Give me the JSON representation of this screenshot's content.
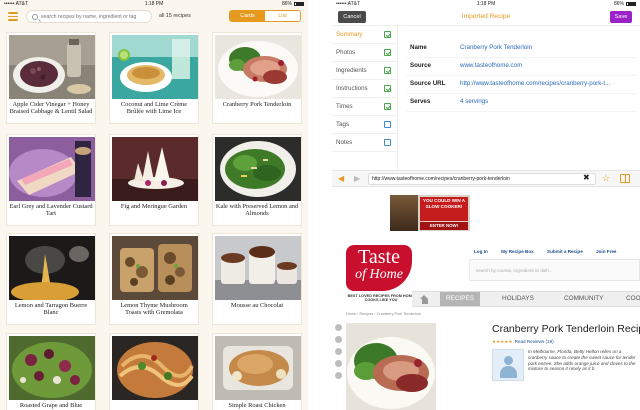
{
  "left": {
    "status": {
      "carrier": "•••••• AT&T",
      "time": "1:18 PM",
      "battery": "86%"
    },
    "search": {
      "placeholder": "search recipes by name, ingredient or tag"
    },
    "count": "all 15 recipes",
    "view_toggle": {
      "cards": "Cards",
      "list": "List",
      "active": "Cards"
    },
    "recipes": [
      {
        "title": "Apple Cider Vinegar + Honey Braised Cabbage & Lentil Salad"
      },
      {
        "title": "Coconut and Lime Crème Brûlée with Lime Ice"
      },
      {
        "title": "Cranberry Pork Tenderloin"
      },
      {
        "title": "Earl Grey and Lavender Custard Tart"
      },
      {
        "title": "Fig and Meringue Garden"
      },
      {
        "title": "Kale with Preserved Lemon and Almonds"
      },
      {
        "title": "Lemon and Tarragon Buerre Blanc"
      },
      {
        "title": "Lemon Thyme Mushroom Toasts with Gremolata"
      },
      {
        "title": "Mousse au Chocolat"
      },
      {
        "title": "Roasted Grape and Blue"
      },
      {
        "title": ""
      },
      {
        "title": "Simple Roast Chicken"
      }
    ]
  },
  "right": {
    "status": {
      "carrier": "•••••• AT&T",
      "time": "1:18 PM",
      "battery": "86%"
    },
    "toolbar": {
      "cancel": "Cancel",
      "title": "Imported Recipe",
      "save": "Save"
    },
    "sections": [
      {
        "label": "Summary",
        "checked": true
      },
      {
        "label": "Photos",
        "checked": true
      },
      {
        "label": "Ingredients",
        "checked": true
      },
      {
        "label": "Instructions",
        "checked": true
      },
      {
        "label": "Times",
        "checked": true
      },
      {
        "label": "Tags",
        "checked": false
      },
      {
        "label": "Notes",
        "checked": false
      }
    ],
    "fields": [
      {
        "label": "Name",
        "value": "Cranberry Pork Tenderloin"
      },
      {
        "label": "Source",
        "value": "www.tasteofhome.com"
      },
      {
        "label": "Source URL",
        "value": "http://www.tasteofhome.com/recipes/cranberry-pork-t..."
      },
      {
        "label": "Serves",
        "value": "4 servings"
      }
    ],
    "browser": {
      "url": "http://www.tasteofhome.com/recipes/cranberry-pork-tenderloin"
    },
    "webpage": {
      "ad": {
        "line1": "YOU COULD WIN A SLOW COOKER!",
        "cta": "ENTER NOW!"
      },
      "logo": {
        "line1": "Taste",
        "line2": "of Home"
      },
      "tagline": "BEST LOVED RECIPES FROM HOME COOKS LIKE YOU",
      "toplinks": [
        "Log In",
        "My Recipe Box",
        "Submit a Recipe",
        "Join Free"
      ],
      "search_placeholder": "search by course, ingredient or dish...",
      "nav": [
        "RECIPES",
        "HOLIDAYS",
        "COMMUNITY",
        "COOKI"
      ],
      "breadcrumbs": "Home  ›  Recipes  ›  Cranberry Pork Tenderloin",
      "recipe_title": "Cranberry Pork Tenderloin Recip",
      "rating": {
        "stars": "★★★★★",
        "reviews": "Read Reviews (19)"
      },
      "quote": "In Melbourne, Florida, Betty Helton relies on a cranberry sauce to create the sweet sauce for tender pork entree. She adds orange juice and cloves to the mixture to season it nicely as it b"
    }
  }
}
